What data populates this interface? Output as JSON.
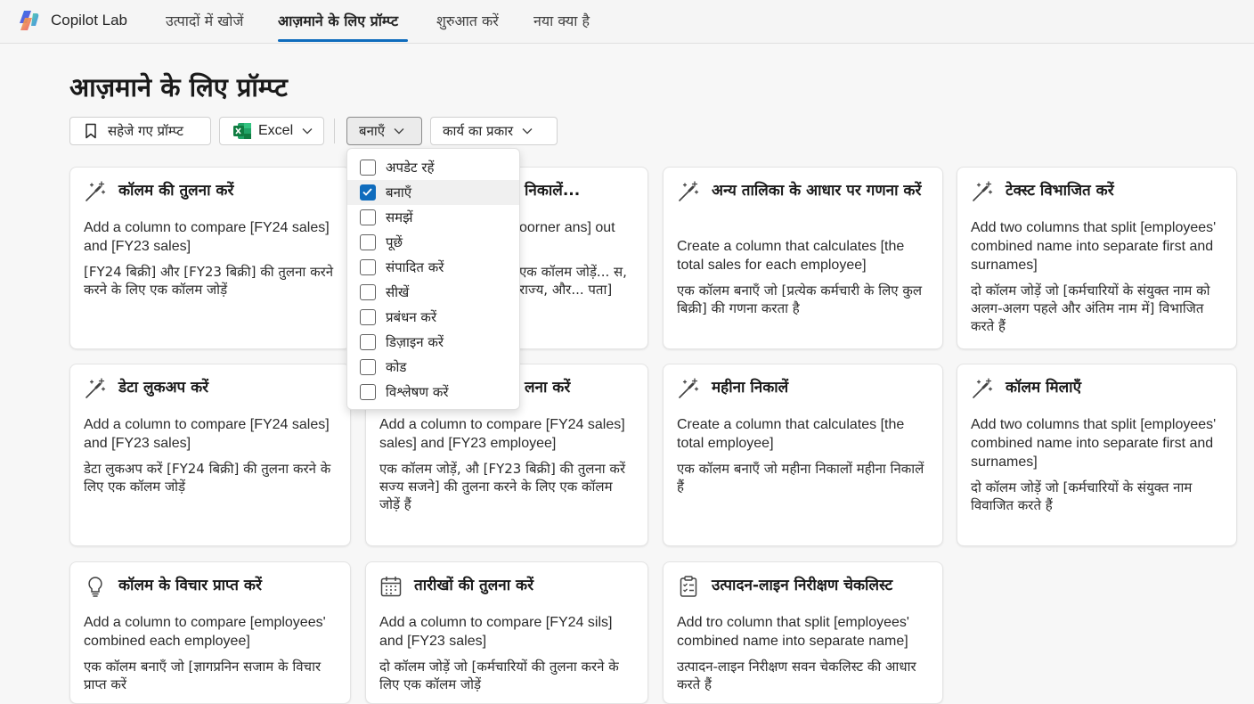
{
  "nav": {
    "brand": "Copilot Lab",
    "tabs": [
      "उत्पादों में खोजें",
      "आज़माने के लिए प्रॉम्प्ट",
      "शुरुआत करें",
      "नया क्या है"
    ]
  },
  "page": {
    "title": "आज़माने के लिए प्रॉम्प्ट"
  },
  "filters": {
    "saved": "सहेजे गए प्रॉम्प्ट",
    "app": "Excel",
    "create": "बनाएँ",
    "task_type": "कार्य का प्रकार"
  },
  "dropdown": {
    "items": [
      {
        "label": "अपडेट रहें",
        "checked": false
      },
      {
        "label": "बनाएँ",
        "checked": true
      },
      {
        "label": "समझें",
        "checked": false
      },
      {
        "label": "पूछें",
        "checked": false
      },
      {
        "label": "संपादित करें",
        "checked": false
      },
      {
        "label": "सीखें",
        "checked": false
      },
      {
        "label": "प्रबंधन करें",
        "checked": false
      },
      {
        "label": "डिज़ाइन करें",
        "checked": false
      },
      {
        "label": "कोड",
        "checked": false
      },
      {
        "label": "विश्लेषण करें",
        "checked": false
      }
    ]
  },
  "cards": [
    {
      "icon": "magic-wand-icon",
      "title": "कॉलम की तुलना करें",
      "en": "Add a column to compare [FY24 sales] and [FY23 sales]",
      "hi": "[FY24 बिक्री] और [FY23 बिक्री] की तुलना करने करने के लिए एक कॉलम जोड़ें"
    },
    {
      "icon": "magic-wand-icon",
      "title": "निकालें...",
      "en": "oorner ans] out",
      "hi": "एक कॉलम जोड़ें... स, राज्य, और... पता]"
    },
    {
      "icon": "magic-wand-icon",
      "title": "अन्य तालिका के आधार पर गणना करें",
      "en": "Create a column that calculates [the total sales for each employee]",
      "hi": "एक कॉलम बनाएँ जो [प्रत्येक कर्मचारी के लिए कुल बिक्री] की गणना करता है"
    },
    {
      "icon": "magic-wand-icon",
      "title": "टेक्स्ट विभाजित करें",
      "en": "Add two columns that split [employees' combined name into separate first and surnames]",
      "hi": "दो कॉलम जोड़ें जो [कर्मचारियों के संयुक्त नाम को अलग-अलग पहले और अंतिम नाम में] विभाजित करते हैं"
    },
    {
      "icon": "magic-wand-icon",
      "title": "डेटा लुकअप करें",
      "en": "Add a column to compare [FY24 sales] and [FY23 sales]",
      "hi": "डेटा लुकअप करें  [FY24 बिक्री] की तुलना करने के लिए एक कॉलम जोड़ें"
    },
    {
      "icon": "magic-wand-icon",
      "title": "लना करें",
      "en": "Add a column to compare [FY24 sales] sales] and [FY23 employee]",
      "hi": "एक कॉलम जोड़ें, औ [FY23 बिक्री] की तुलना करें सज्य सजने] की तुलना करने के लिए एक कॉलम जोड़ें हैं"
    },
    {
      "icon": "magic-wand-icon",
      "title": "महीना निकालें",
      "en": "Create a column that calculates [the total employee]",
      "hi": "एक कॉलम बनाएँ जो महीना निकालों महीना निकालें हैं"
    },
    {
      "icon": "magic-wand-icon",
      "title": "कॉलम मिलाएँ",
      "en": "Add two columns that split [employees' combined name into separate first and surnames]",
      "hi": "दो कॉलम जोड़ें जो [कर्मचारियों के संयुक्त नाम विवाजित करते हैं"
    },
    {
      "icon": "lightbulb-icon",
      "title": "कॉलम के विचार प्राप्त करें",
      "en": "Add a column to compare [employees' combined each employee]",
      "hi": "एक कॉलम बनाएँ जो [ज्ञागप्रनिन सजाम के विचार प्राप्त करें"
    },
    {
      "icon": "calendar-icon",
      "title": "तारीखों की तुलना करें",
      "en": "Add a column to compare [FY24 sils] and [FY23 sales]",
      "hi": "दो कॉलम जोड़ें जो [कर्मचारियों की तुलना करने के लिए एक कॉलम जोड़ें"
    },
    {
      "icon": "checklist-icon",
      "title": "उत्पादन-लाइन निरीक्षण चेकलिस्ट",
      "en": "Add tro column that split [employees' combined name into separate name]",
      "hi": "उत्पादन-लाइन निरीक्षण सवन चेकलिस्ट की आधार करते हैं"
    }
  ]
}
